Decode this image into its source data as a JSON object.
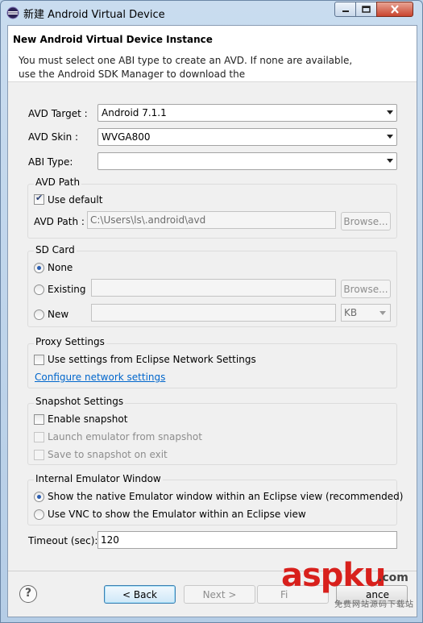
{
  "window": {
    "title": "新建 Android Virtual Device"
  },
  "header": {
    "title": "New Android Virtual Device Instance",
    "message": "You must select one ABI type to create an AVD. If none are available, use the Android SDK Manager to download the"
  },
  "form": {
    "avd_target_label": "AVD Target :",
    "avd_target_value": "Android 7.1.1",
    "avd_skin_label": "AVD Skin :",
    "avd_skin_value": "WVGA800",
    "abi_type_label": "ABI Type:",
    "abi_type_value": ""
  },
  "avd_path": {
    "group_title": "AVD Path",
    "use_default_label": "Use default",
    "use_default_checked": true,
    "path_label": "AVD Path :",
    "path_value": "C:\\Users\\ls\\.android\\avd",
    "browse_label": "Browse..."
  },
  "sd_card": {
    "group_title": "SD Card",
    "none_label": "None",
    "existing_label": "Existing",
    "existing_value": "",
    "browse_label": "Browse...",
    "new_label": "New",
    "new_size_value": "",
    "unit_value": "KB",
    "selected": "None"
  },
  "proxy": {
    "group_title": "Proxy Settings",
    "use_eclipse_label": "Use settings from Eclipse Network Settings",
    "configure_link": "Configure network settings"
  },
  "snapshot": {
    "group_title": "Snapshot Settings",
    "enable_label": "Enable snapshot",
    "launch_label": "Launch emulator from snapshot",
    "save_label": "Save to snapshot on exit"
  },
  "emulator_window": {
    "group_title": "Internal Emulator Window",
    "native_label": "Show the native Emulator window within an Eclipse view (recommended)",
    "vnc_label": "Use VNC to show the Emulator within an Eclipse view",
    "selected": "native"
  },
  "timeout": {
    "label": "Timeout (sec):",
    "value": "120"
  },
  "buttons": {
    "help_label": "?",
    "back_label": "< Back",
    "next_label": "Next >",
    "finish_label": "Fi",
    "cancel_label": "ance"
  },
  "watermark": {
    "brand": "aspku",
    "domain": ".com",
    "tagline": "免费网站源码下载站"
  },
  "colors": {
    "link": "#0066cc",
    "watermark_red": "#d8201c",
    "close_button": "#c9452f"
  }
}
